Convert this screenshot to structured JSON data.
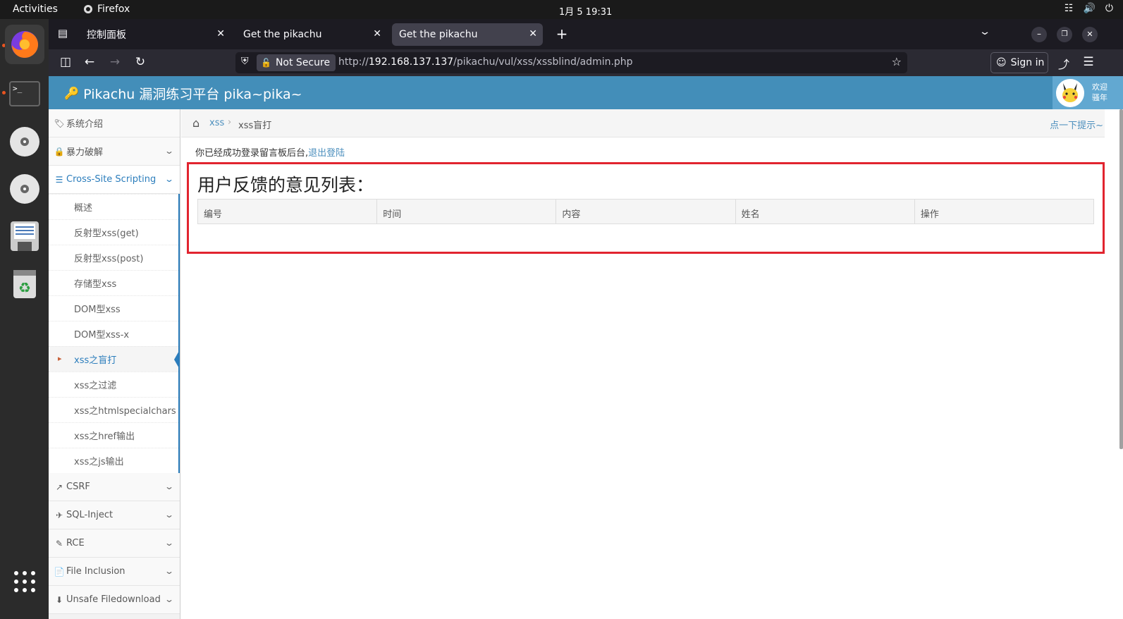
{
  "system": {
    "activities": "Activities",
    "app_name": "Firefox",
    "clock": "1月 5  19:31"
  },
  "browser": {
    "tabs": [
      {
        "label": "控制面板"
      },
      {
        "label": "Get the pikachu"
      },
      {
        "label": "Get the pikachu"
      }
    ],
    "not_secure": "Not Secure",
    "url_prefix": "http://",
    "url_host": "192.168.137.137",
    "url_path": "/pikachu/vul/xss/xssblind/admin.php",
    "sign_in": "Sign in"
  },
  "site": {
    "brand": "Pikachu 漏洞练习平台 pika~pika~",
    "welcome_line1": "欢迎",
    "welcome_line2": "骚年"
  },
  "sidebar": {
    "items_top": [
      {
        "label": "系统介绍",
        "icon": "tag-icon"
      },
      {
        "label": "暴力破解",
        "icon": "lock-icon"
      },
      {
        "label": "Cross-Site Scripting",
        "icon": "list-icon"
      }
    ],
    "xss_sub": [
      {
        "label": "概述"
      },
      {
        "label": "反射型xss(get)"
      },
      {
        "label": "反射型xss(post)"
      },
      {
        "label": "存储型xss"
      },
      {
        "label": "DOM型xss"
      },
      {
        "label": "DOM型xss-x"
      },
      {
        "label": "xss之盲打"
      },
      {
        "label": "xss之过滤"
      },
      {
        "label": "xss之htmlspecialchars"
      },
      {
        "label": "xss之href输出"
      },
      {
        "label": "xss之js输出"
      }
    ],
    "items_bottom": [
      {
        "label": "CSRF",
        "icon": "external-link-icon"
      },
      {
        "label": "SQL-Inject",
        "icon": "plane-icon"
      },
      {
        "label": "RCE",
        "icon": "pencil-icon"
      },
      {
        "label": "File Inclusion",
        "icon": "file-icon"
      },
      {
        "label": "Unsafe Filedownload",
        "icon": "download-icon"
      }
    ]
  },
  "main": {
    "breadcrumb_link": "xss",
    "breadcrumb_current": "xss盲打",
    "hint": "点一下提示~",
    "login_msg": "你已经成功登录留言板后台,",
    "logout": "退出登陆",
    "list_title": "用户反馈的意见列表：",
    "columns": [
      "编号",
      "时间",
      "内容",
      "姓名",
      "操作"
    ]
  },
  "colors": {
    "header": "#438eb9",
    "accent": "#2b7dbc",
    "highlight_box": "#e1242f"
  }
}
